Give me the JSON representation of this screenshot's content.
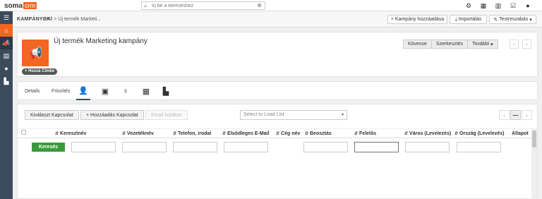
{
  "app": {
    "logo_part1": "soma",
    "logo_part2": "crm"
  },
  "search": {
    "placeholder": "Írj be a kereséshez"
  },
  "top_icons": [
    "gear-icon",
    "calendar-icon",
    "bar-chart-icon",
    "checkbox-icon",
    "user-icon"
  ],
  "sidebar": {
    "items": [
      "home-icon",
      "megaphone-icon",
      "contacts-icon",
      "person-icon",
      "building-icon"
    ]
  },
  "breadcrumb": {
    "module": "KAMPÁNYOK",
    "trail": "> All > Új termék Marketi..."
  },
  "toolbar": {
    "add_campaign": "Kampány hozzáadása",
    "import": "Importálás",
    "customize": "Testreszabás"
  },
  "record": {
    "title": "Új termék Marketing kampány",
    "add_tag": "Hozzá Címke",
    "follow": "Kövesse",
    "edit": "Szerkesztés",
    "more": "További"
  },
  "tabs": {
    "details": "Details",
    "updates": "Frissítés",
    "icons": [
      "person-icon",
      "contact-card-icon",
      "money-bag-icon",
      "calendar-icon",
      "building-icon"
    ]
  },
  "panel": {
    "select_relation": "Kiválaszt Kapcsolat",
    "add_relation": "Hozzáadás Kapcsolat",
    "send_email": "Email küldése",
    "load_list_placeholder": "Select to Load List",
    "search_button": "Keresés",
    "columns": [
      "Keresztnév",
      "Vezetéknév",
      "Telefon, irodai",
      "Elsődleges E-Mail",
      "Cég név",
      "Beosztás",
      "Felelős",
      "Város (Levelezés)",
      "Ország (Levelezés)",
      "Állapot"
    ]
  },
  "colors": {
    "brand": "#f26522",
    "sidebar": "#3c4b5c",
    "search_button": "#3a9a3a"
  }
}
